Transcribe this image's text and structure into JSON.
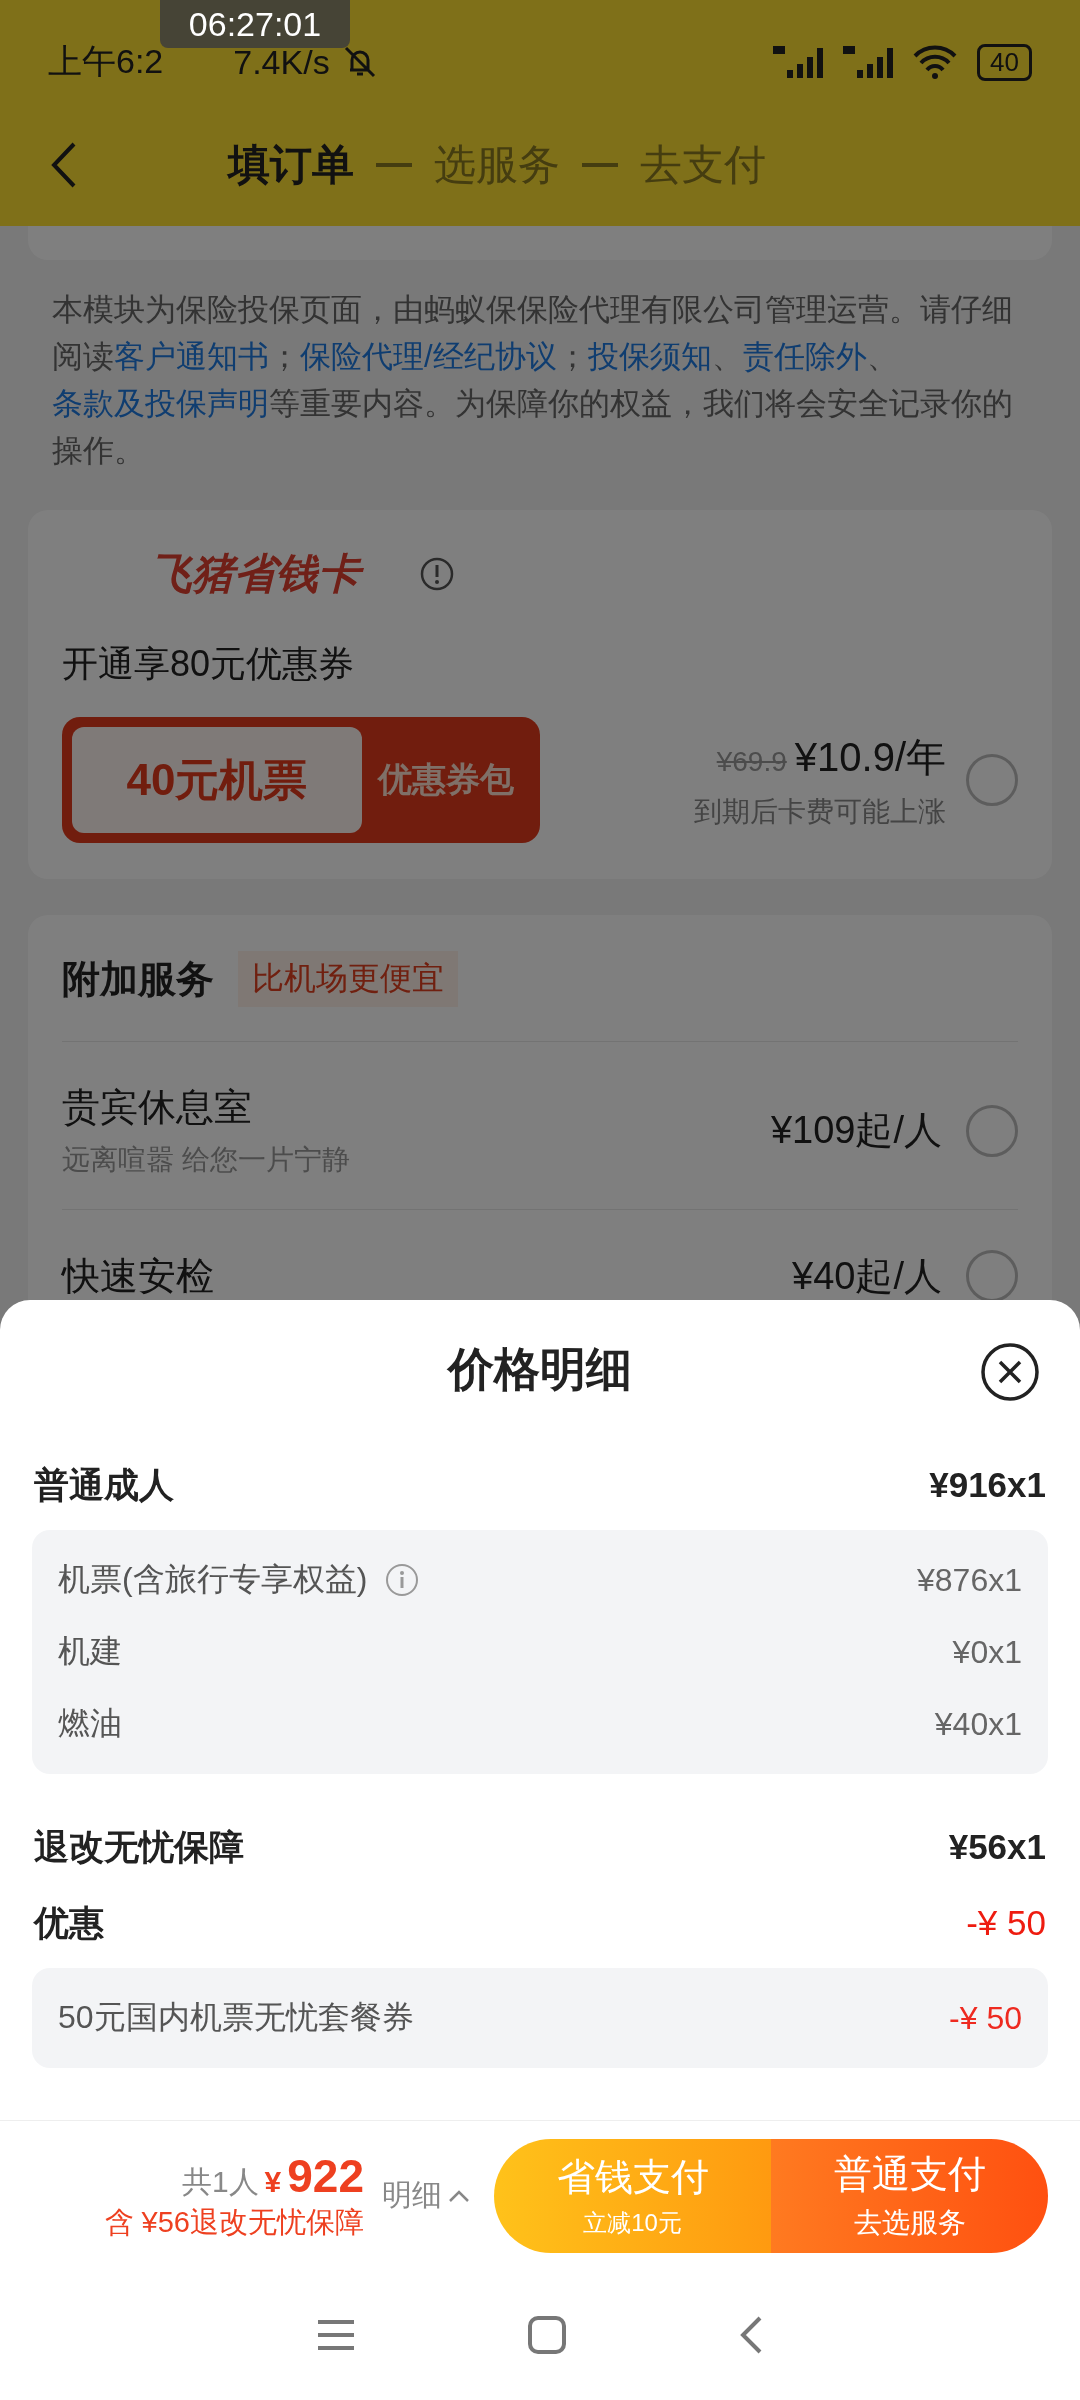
{
  "status_bar": {
    "recording_time": "06:27:01",
    "time": "上午6:2",
    "net_speed": "7.4K/s",
    "battery": "40"
  },
  "header": {
    "steps": [
      {
        "label": "填订单",
        "selected": true
      },
      {
        "label": "选服务",
        "selected": false
      },
      {
        "label": "去支付",
        "selected": false
      }
    ]
  },
  "notice": [
    {
      "text": "本模块为保险投保页面，由蚂蚁保保险代理有限公司管理运营。请仔细阅读",
      "kind": "plain"
    },
    {
      "text": "客户通知书",
      "kind": "link"
    },
    {
      "text": "；",
      "kind": "plain"
    },
    {
      "text": "保险代理/经纪协议",
      "kind": "link"
    },
    {
      "text": "；",
      "kind": "plain"
    },
    {
      "text": "投保须知",
      "kind": "link"
    },
    {
      "text": "、",
      "kind": "plain"
    },
    {
      "text": "责任除外",
      "kind": "link"
    },
    {
      "text": "、",
      "kind": "plain"
    },
    {
      "text": "条款及投保声明",
      "kind": "link"
    },
    {
      "text": "等重要内容。为保障你的权益，我们将会安全记录你的操作。",
      "kind": "plain"
    }
  ],
  "savings_card": {
    "brand": "飞猪省钱卡",
    "headline": "开通享80元优惠券",
    "coupon": {
      "value": "40元机票",
      "label": "优惠券包"
    },
    "original_price": "¥69.9",
    "price": "¥10.9/年",
    "note": "到期后卡费可能上涨",
    "selected": false
  },
  "services": {
    "title": "附加服务",
    "tag": "比机场更便宜",
    "items": [
      {
        "name": "贵宾休息室",
        "desc": "远离喧嚣 给您一片宁静",
        "price": "¥109起/人",
        "selected": false
      },
      {
        "name": "快速安检",
        "price": "¥40起/人",
        "selected": false
      }
    ]
  },
  "sheet": {
    "title": "价格明细",
    "sections": [
      {
        "label": "普通成人",
        "amount": "¥916x1",
        "kind": "charge",
        "details": [
          {
            "label": "机票(含旅行专享权益)",
            "amount": "¥876x1",
            "info": true
          },
          {
            "label": "机建",
            "amount": "¥0x1",
            "info": false
          },
          {
            "label": "燃油",
            "amount": "¥40x1",
            "info": false
          }
        ]
      },
      {
        "label": "退改无忧保障",
        "amount": "¥56x1",
        "kind": "charge"
      },
      {
        "label": "优惠",
        "amount": "-¥ 50",
        "kind": "discount",
        "details": [
          {
            "label": "50元国内机票无忧套餐券",
            "amount": "-¥ 50",
            "info": false
          }
        ]
      }
    ]
  },
  "footer": {
    "count": "共1人",
    "currency": "¥",
    "total": "922",
    "note": "含 ¥56退改无忧保障",
    "details_toggle": "明细",
    "buttons": [
      {
        "label": "省钱支付",
        "sub": "立减10元",
        "kind": "save"
      },
      {
        "label": "普通支付",
        "sub": "去选服务",
        "kind": "normal"
      }
    ]
  }
}
